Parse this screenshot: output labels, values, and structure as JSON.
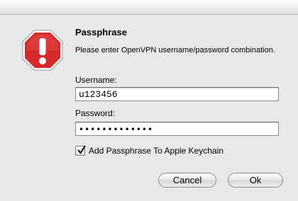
{
  "dialog": {
    "title": "Passphrase",
    "message": "Please enter OpenVPN username/password combination.",
    "icon": "stop-alert-icon",
    "colors": {
      "alert_red": "#d42a2a",
      "background": "#e8e8e8"
    }
  },
  "username": {
    "label": "Username:",
    "value": "u123456"
  },
  "password": {
    "label": "Password:",
    "value": "•••••••••••••"
  },
  "keychain": {
    "label": "Add Passphrase To Apple Keychain",
    "checked": true
  },
  "buttons": {
    "cancel": "Cancel",
    "ok": "Ok"
  }
}
